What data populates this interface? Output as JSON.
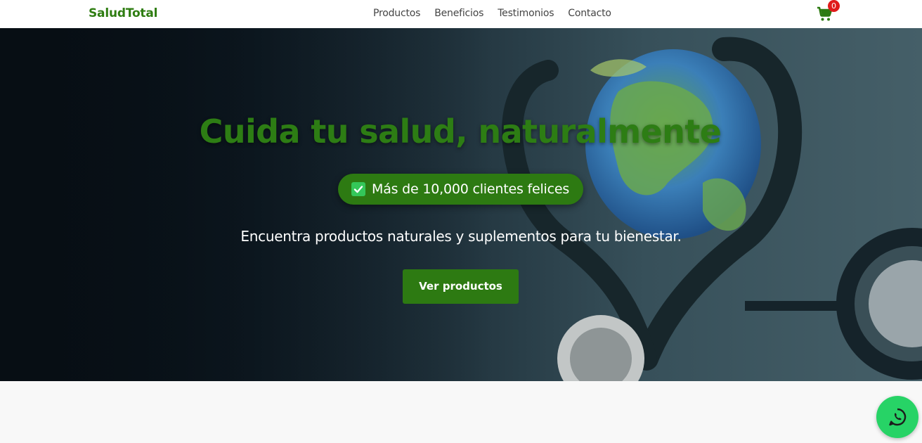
{
  "nav": {
    "brand": "SaludTotal",
    "links": [
      "Productos",
      "Beneficios",
      "Testimonios",
      "Contacto"
    ],
    "cart_count": "0",
    "cart_icon": "shopping-cart-icon"
  },
  "hero": {
    "title": "Cuida tu salud, naturalmente",
    "badge_text": "Más de 10,000 clientes felices",
    "badge_icon": "check-square-icon",
    "subtitle": "Encuentra productos naturales y suplementos para tu bienestar.",
    "cta_label": "Ver productos",
    "background_image": "stethoscope-heart-globe"
  },
  "floating": {
    "whatsapp_icon": "whatsapp-icon"
  },
  "colors": {
    "brand_green": "#2d7a12",
    "badge_red": "#e01b1b",
    "whatsapp_green": "#27d366"
  }
}
